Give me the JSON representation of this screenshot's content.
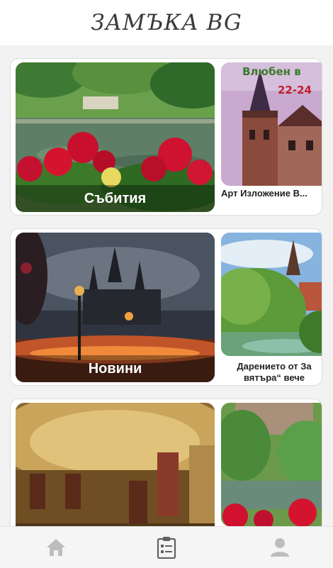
{
  "header": {
    "title": "ЗАМЪКА BG"
  },
  "sections": [
    {
      "title": "Събития",
      "side_item": "Арт Изложение В...",
      "side_banner_line1": "Влюбен в",
      "side_banner_line2": "22-24"
    },
    {
      "title": "Новини",
      "side_item_line1": "Дарението от За",
      "side_item_line2": "вятъра“ вече"
    },
    {
      "title": "",
      "side_item": ""
    }
  ],
  "nav": {
    "items": [
      {
        "name": "home",
        "icon": "home-icon",
        "active": false
      },
      {
        "name": "list",
        "icon": "clipboard-list-icon",
        "active": true
      },
      {
        "name": "profile",
        "icon": "user-icon",
        "active": false
      }
    ]
  },
  "colors": {
    "icon_inactive": "#bdbdbd",
    "icon_active": "#616161",
    "title": "#3a3a3a"
  }
}
